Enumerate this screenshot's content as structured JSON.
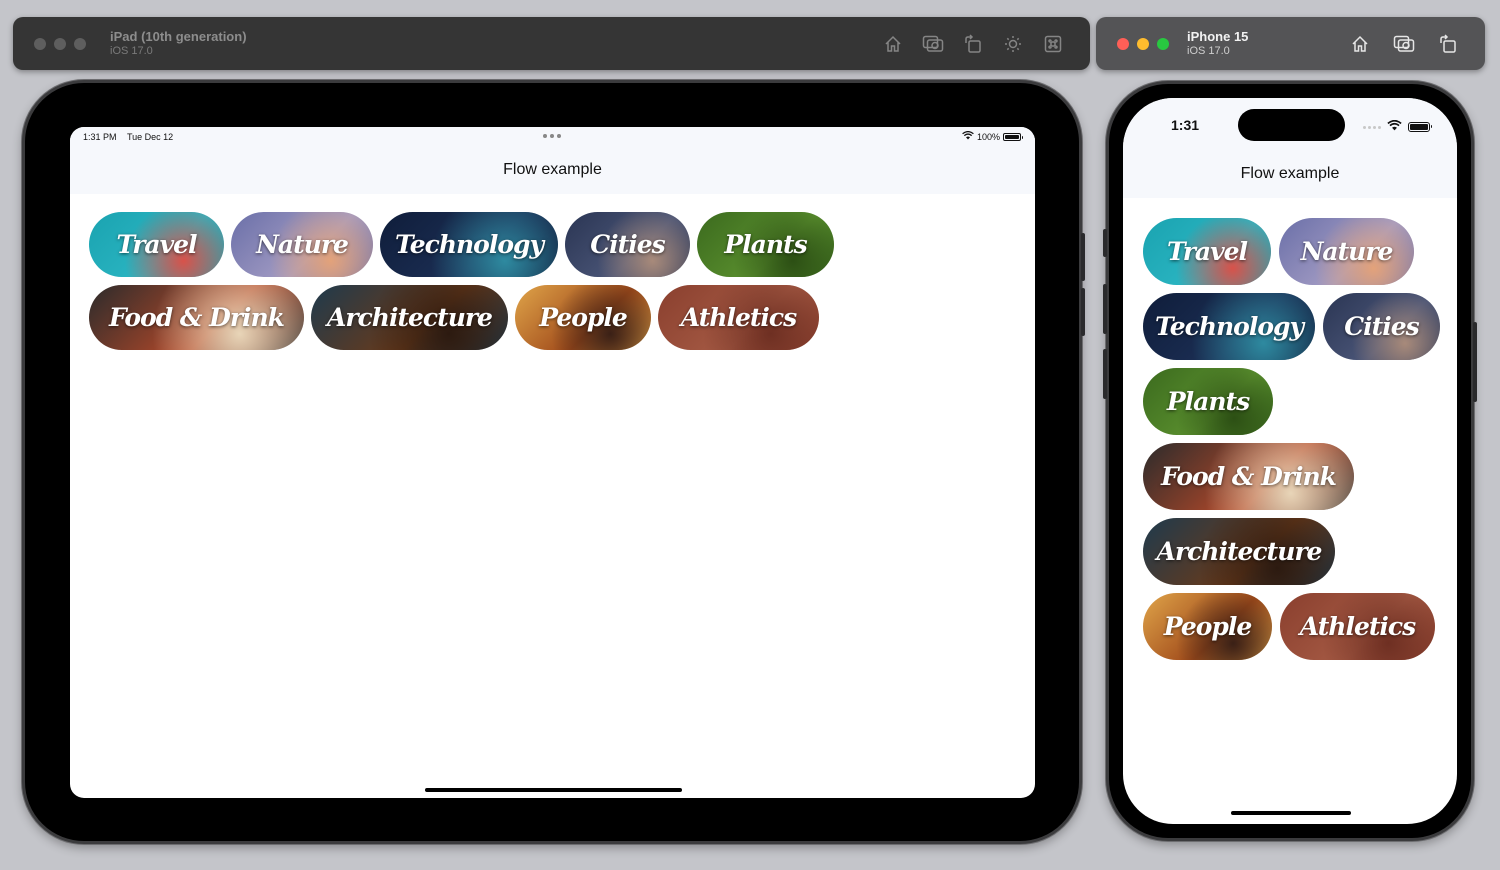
{
  "simulators": [
    {
      "name": "iPad (10th generation)",
      "os": "iOS 17.0",
      "toolbar_icons": [
        "home-icon",
        "screenshot-icon",
        "rotate-icon",
        "appearance-icon",
        "command-icon"
      ]
    },
    {
      "name": "iPhone 15",
      "os": "iOS 17.0",
      "toolbar_icons": [
        "home-icon",
        "screenshot-icon",
        "rotate-icon"
      ]
    }
  ],
  "ipad": {
    "status": {
      "time": "1:31 PM",
      "date": "Tue Dec 12",
      "battery": "100%"
    },
    "nav_title": "Flow example"
  },
  "iphone": {
    "status": {
      "time": "1:31"
    },
    "nav_title": "Flow example"
  },
  "tags": [
    {
      "label": "Travel",
      "colors": [
        "#1aa3b0",
        "#2bb5c2",
        "#d8524a"
      ]
    },
    {
      "label": "Nature",
      "colors": [
        "#6a6fa8",
        "#a39cc4",
        "#e3a27a"
      ]
    },
    {
      "label": "Technology",
      "colors": [
        "#0f1d3a",
        "#1c2f55",
        "#2e8aa0"
      ]
    },
    {
      "label": "Cities",
      "colors": [
        "#2a3553",
        "#4a5577",
        "#a88a7a"
      ]
    },
    {
      "label": "Plants",
      "colors": [
        "#3b6a1e",
        "#5a8f2e",
        "#2c4f14"
      ]
    },
    {
      "label": "Food & Drink",
      "colors": [
        "#2b2b2b",
        "#b5492a",
        "#e8d5b8"
      ]
    },
    {
      "label": "Architecture",
      "colors": [
        "#1e3a4d",
        "#6a3a1a",
        "#2c1a10"
      ]
    },
    {
      "label": "People",
      "colors": [
        "#e0a54a",
        "#a04a1a",
        "#3a2016"
      ]
    },
    {
      "label": "Athletics",
      "colors": [
        "#8a3f2e",
        "#a55a44",
        "#6e2f22"
      ]
    }
  ]
}
